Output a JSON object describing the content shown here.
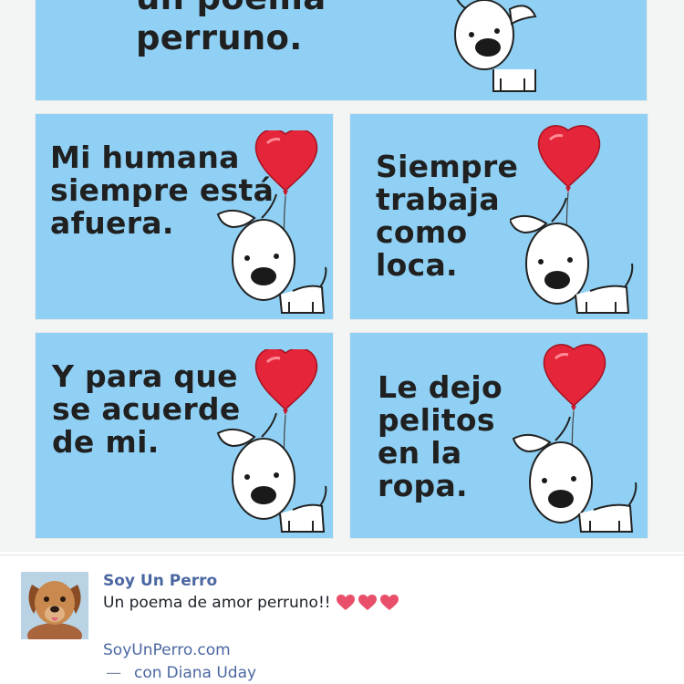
{
  "comic": {
    "top_text": "un poema\nperruno.",
    "panels": [
      {
        "text": "Mi humana\nsiempre está\nafuera."
      },
      {
        "text": "Siempre\ntrabaja\ncomo\nloca."
      },
      {
        "text": "Y para que\nse acuerde\nde mi."
      },
      {
        "text": "Le dejo\npelitos\nen la\nropa."
      }
    ]
  },
  "post": {
    "page_name": "Soy Un Perro",
    "caption": "Un poema de amor perruno!!",
    "link": "SoyUnPerro.com",
    "dash": "—",
    "with_label": "con",
    "tagged_name": "Diana Uday"
  },
  "colors": {
    "panel": "#8fd0f4",
    "heart": "#e5263a",
    "link": "#4b67a1"
  },
  "icons": [
    "dog-balloon-illustration",
    "heart-icon",
    "puppy-avatar"
  ]
}
